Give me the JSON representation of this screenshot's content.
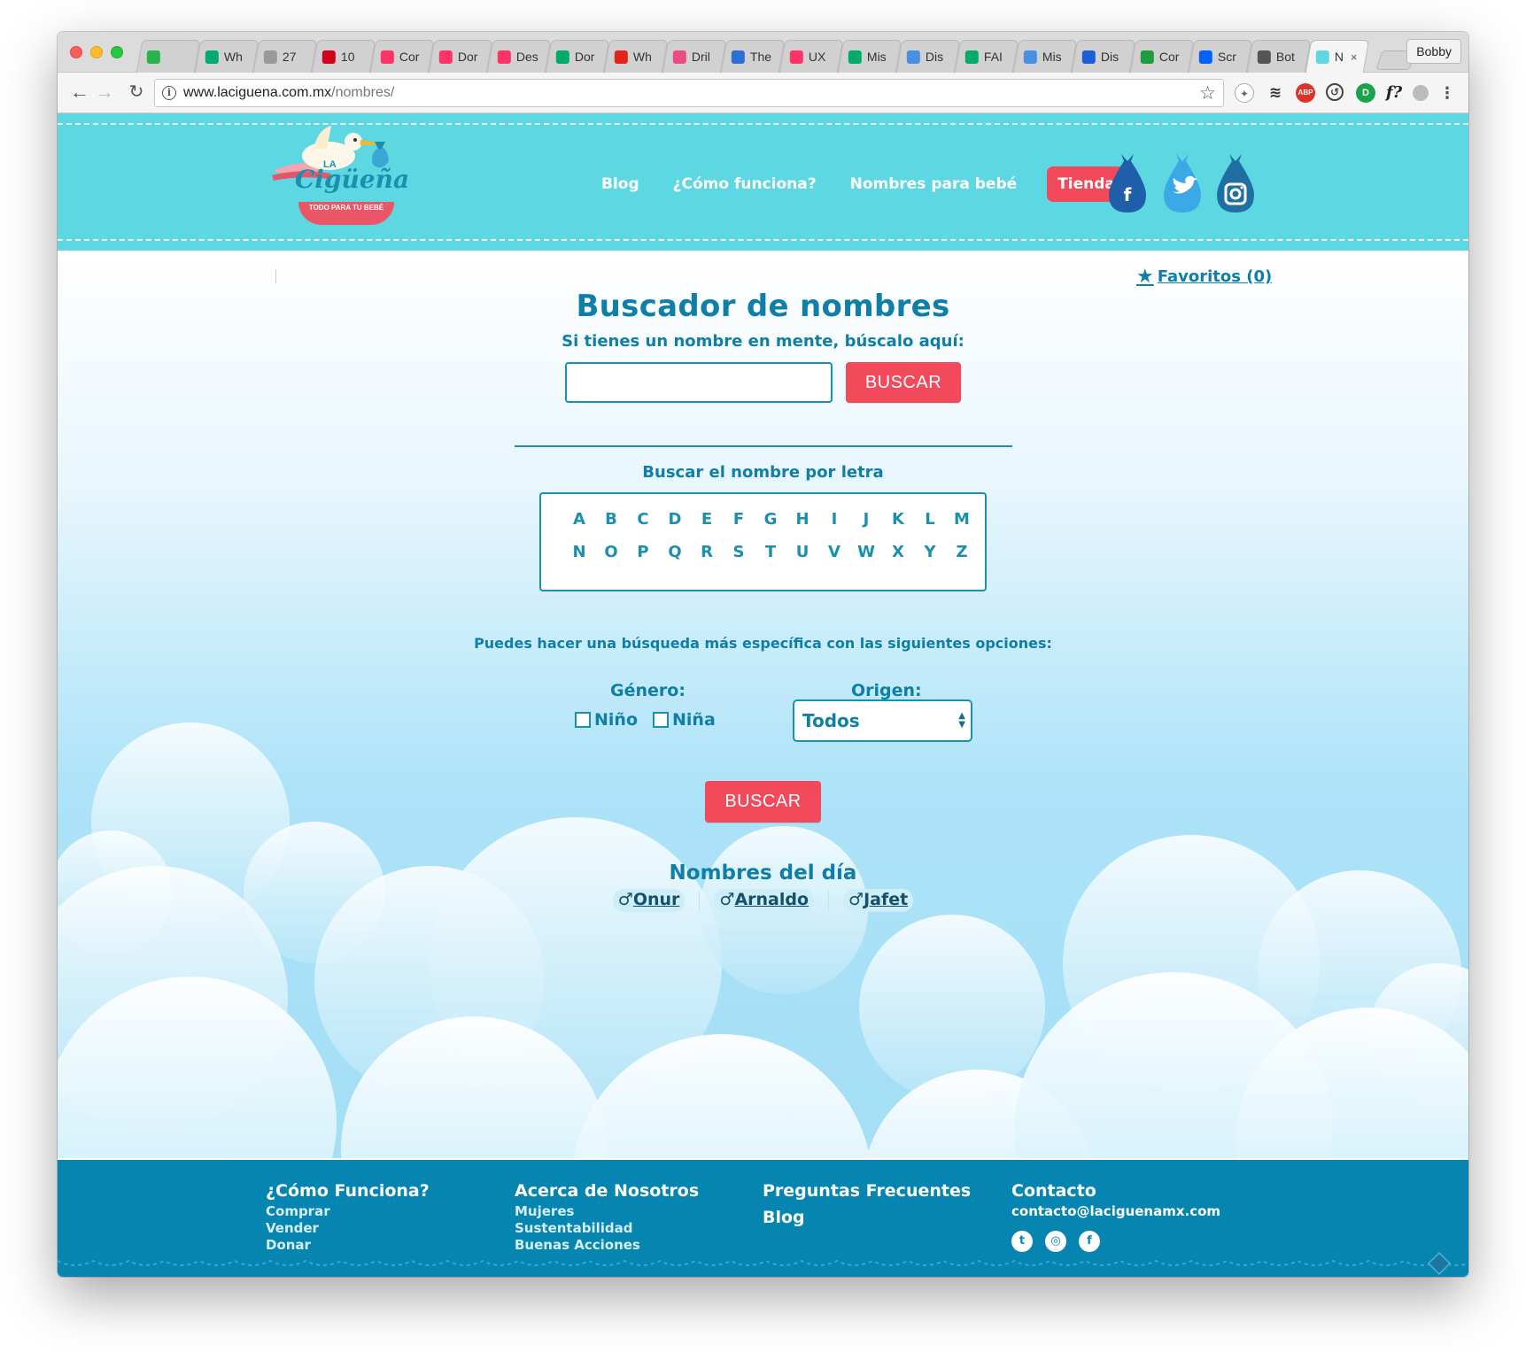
{
  "browser": {
    "tabs": [
      {
        "label": "",
        "icon": "feedly-icon",
        "color": "#2bb24c"
      },
      {
        "label": "Wh",
        "icon": "medium-icon",
        "color": "#00ab6c"
      },
      {
        "label": "27",
        "icon": "page-icon",
        "color": "#999999"
      },
      {
        "label": "10",
        "icon": "nn-icon",
        "color": "#d0021b"
      },
      {
        "label": "Cor",
        "icon": "invision-icon",
        "color": "#ff3366"
      },
      {
        "label": "Dor",
        "icon": "invision-icon",
        "color": "#ff3366"
      },
      {
        "label": "Des",
        "icon": "invision-icon",
        "color": "#ff3366"
      },
      {
        "label": "Dor",
        "icon": "medium-icon",
        "color": "#00ab6c"
      },
      {
        "label": "Wh",
        "icon": "adobe-icon",
        "color": "#e1251b"
      },
      {
        "label": "Dril",
        "icon": "dribbble-icon",
        "color": "#ea4c89"
      },
      {
        "label": "The",
        "icon": "wave-icon",
        "color": "#2d6fd2"
      },
      {
        "label": "UX",
        "icon": "invision-icon",
        "color": "#ff3366"
      },
      {
        "label": "Mis",
        "icon": "medium-icon",
        "color": "#00ab6c"
      },
      {
        "label": "Dis",
        "icon": "h-icon",
        "color": "#4a90e2"
      },
      {
        "label": "FAI",
        "icon": "medium-icon",
        "color": "#00ab6c"
      },
      {
        "label": "Mis",
        "icon": "h-icon",
        "color": "#4a90e2"
      },
      {
        "label": "Dis",
        "icon": "h-icon",
        "color": "#1a5fd6"
      },
      {
        "label": "Cor",
        "icon": "w-icon",
        "color": "#1f9c3d"
      },
      {
        "label": "Scr",
        "icon": "dropbox-icon",
        "color": "#0061fe"
      },
      {
        "label": "Bot",
        "icon": "diamond-icon",
        "color": "#555555"
      },
      {
        "label": "N",
        "icon": "stork-icon",
        "color": "#5dd7e2",
        "active": true
      }
    ],
    "profile": "Bobby",
    "url_host": "www.laciguena.com.mx",
    "url_path": "/nombres/"
  },
  "site": {
    "logo_text": "Cigüeña",
    "logo_la": "LA",
    "logo_tagline": "TODO PARA TU BEBÉ",
    "nav": {
      "blog": "Blog",
      "como": "¿Cómo funciona?",
      "nombres": "Nombres para bebé",
      "tienda": "Tienda"
    },
    "colors": {
      "header": "#5dd7e2",
      "accent": "#f24a5a",
      "primary": "#0f7fa8",
      "footer": "#0585b0"
    }
  },
  "main": {
    "favorites": "Favoritos (0)",
    "title": "Buscador de nombres",
    "subtitle": "Si tienes un nombre en mente, búscalo aquí:",
    "search_value": "",
    "search_button": "BUSCAR",
    "letter_label": "Buscar el nombre por letra",
    "letters": [
      "A",
      "B",
      "C",
      "D",
      "E",
      "F",
      "G",
      "H",
      "I",
      "J",
      "K",
      "L",
      "M",
      "N",
      "O",
      "P",
      "Q",
      "R",
      "S",
      "T",
      "U",
      "V",
      "W",
      "X",
      "Y",
      "Z"
    ],
    "specific_label": "Puedes hacer una búsqueda más específica con las siguientes opciones:",
    "genero_label": "Género:",
    "nino": "Niño",
    "nina": "Niña",
    "origen_label": "Origen:",
    "origen_value": "Todos",
    "buscar_button": "BUSCAR",
    "dia_title": "Nombres del día",
    "dia_names": [
      {
        "symbol": "♂",
        "name": "Onur"
      },
      {
        "symbol": "♂",
        "name": "Arnaldo"
      },
      {
        "symbol": "♂",
        "name": "Jafet"
      }
    ]
  },
  "footer": {
    "col1": {
      "title": "¿Cómo Funciona?",
      "items": [
        "Comprar",
        "Vender",
        "Donar"
      ]
    },
    "col2": {
      "title": "Acerca de Nosotros",
      "items": [
        "Mujeres",
        "Sustentabilidad",
        "Buenas Acciones"
      ]
    },
    "col3": {
      "title": "Preguntas Frecuentes",
      "item": "Blog"
    },
    "col4": {
      "title": "Contacto",
      "email": "contacto@laciguenamx.com"
    }
  }
}
